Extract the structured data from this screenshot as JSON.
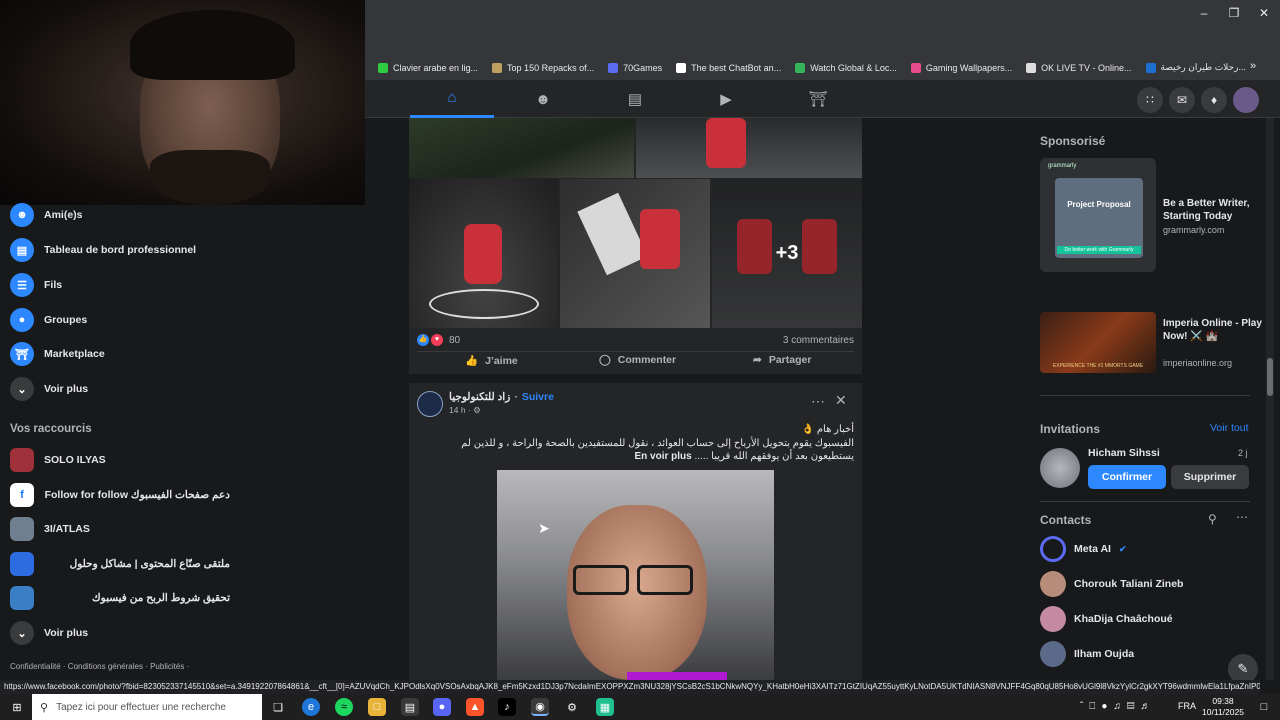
{
  "bookmarks": [
    {
      "label": "Clavier arabe en lig...",
      "color": "#2ecc40"
    },
    {
      "label": "Top 150 Repacks of...",
      "color": "#c0a060"
    },
    {
      "label": "70Games",
      "color": "#5b6cf2"
    },
    {
      "label": "The best ChatBot an...",
      "color": "#ffffff"
    },
    {
      "label": "Watch Global & Loc...",
      "color": "#35b35a"
    },
    {
      "label": "Gaming Wallpapers...",
      "color": "#e84c8a"
    },
    {
      "label": "OK LIVE TV - Online...",
      "color": "#dddddd"
    },
    {
      "label": "رحلات طيران رخيصة...",
      "color": "#1d6fd1"
    }
  ],
  "left_nav": {
    "items": [
      {
        "label": "Ami(e)s",
        "icon": "friends-icon",
        "color": "#2d88ff"
      },
      {
        "label": "Tableau de bord professionnel",
        "icon": "dashboard-icon",
        "color": "#2d88ff"
      },
      {
        "label": "Fils",
        "icon": "feeds-icon",
        "color": "#2d88ff"
      },
      {
        "label": "Groupes",
        "icon": "groups-icon",
        "color": "#2d88ff"
      },
      {
        "label": "Marketplace",
        "icon": "marketplace-icon",
        "color": "#2d88ff"
      },
      {
        "label": "Voir plus",
        "icon": "chevron-down-icon",
        "color": "#3a3b3c"
      }
    ],
    "shortcuts_title": "Vos raccourcis",
    "shortcuts": [
      {
        "label": "SOLO ILYAS",
        "color": "#a0303a"
      },
      {
        "label": "Follow for follow دعم صفحات الفيسبوك",
        "color": "#ffffff"
      },
      {
        "label": "3I/ATLAS",
        "color": "#6f7f8f"
      },
      {
        "label": "ملتقى صنّاع المحتوى | مشاكل وحلول",
        "color": "#2d6be0"
      },
      {
        "label": "تحقيق شروط الربح من فيسبوك",
        "color": "#3a7fc4"
      },
      {
        "label": "Voir plus",
        "color": "#3a3b3c"
      }
    ],
    "footer": "Confidentialité · Conditions générales · Publicités ·"
  },
  "post1": {
    "overlay_count": "+3",
    "reactions_count": "80",
    "comments": "3 commentaires",
    "like": "J’aime",
    "comment": "Commenter",
    "share": "Partager"
  },
  "post2": {
    "page_name": "زاد للتكنولوجيا",
    "follow": "Suivre",
    "time": "14 h ·",
    "line1": "أخبار هام 👌",
    "line2": "الفيسبوك يقوم بتحويل الأرباح إلى حساب العوائد ، نقول للمستفيدين بالصحة والراحة ، و للذين لم",
    "line3": "يستطيعون بعد  أن يوفقهم الله قريبا .....",
    "see_more": "En voir plus"
  },
  "right": {
    "sponsored_title": "Sponsorisé",
    "ads": [
      {
        "title": "Be a Better Writer, Starting Today",
        "domain": "grammarly.com",
        "card_title": "Project Proposal",
        "card_cta": "Do better work with Grammarly",
        "brand": "grammarly"
      },
      {
        "title": "Imperia Online - Play Now! ⚔️ 🏰",
        "domain": "imperiaonline.org",
        "banner": "EXPERIENCE THE #1 MMORTS GAME"
      }
    ],
    "invitations_title": "Invitations",
    "see_all": "Voir tout",
    "invite": {
      "name": "Hicham Sihssi",
      "time": "2 j",
      "confirm": "Confirmer",
      "delete": "Supprimer"
    },
    "contacts_title": "Contacts",
    "contacts": [
      {
        "name": "Meta AI",
        "color": "#5b6cf2"
      },
      {
        "name": "Chorouk Taliani Zineb",
        "color": "#b88c7a"
      },
      {
        "name": "KhaDija Chaâchoué",
        "color": "#c58aa0"
      },
      {
        "name": "Ilham Oujda",
        "color": "#5c6a8a"
      }
    ]
  },
  "status_url": "https://www.facebook.com/photo/?fbid=823052337145510&set=a.349192207864861&__cft__[0]=AZUVqdCh_KJPOdlsXq0VSOsAxbqAJK8_eFm5Kzxd1DJ3p7NcdaImEXOPPXZm3NU328jYSCsB2cS1bCNkwNQYy_KHatbH0eHi3XAITz71GtZIUqAZ55uyttKyLNotDA5UKTdNIASN8VNJFF4Gq80qU85Ho8vUGl9l8VkzYylCr2gkXYT96wdmmlwEla1LfpaZnIP0smLhb9zp",
  "taskbar": {
    "search_placeholder": "Tapez ici pour effectuer une recherche",
    "lang": "FRA",
    "time": "09:38",
    "date": "10/11/2025"
  }
}
